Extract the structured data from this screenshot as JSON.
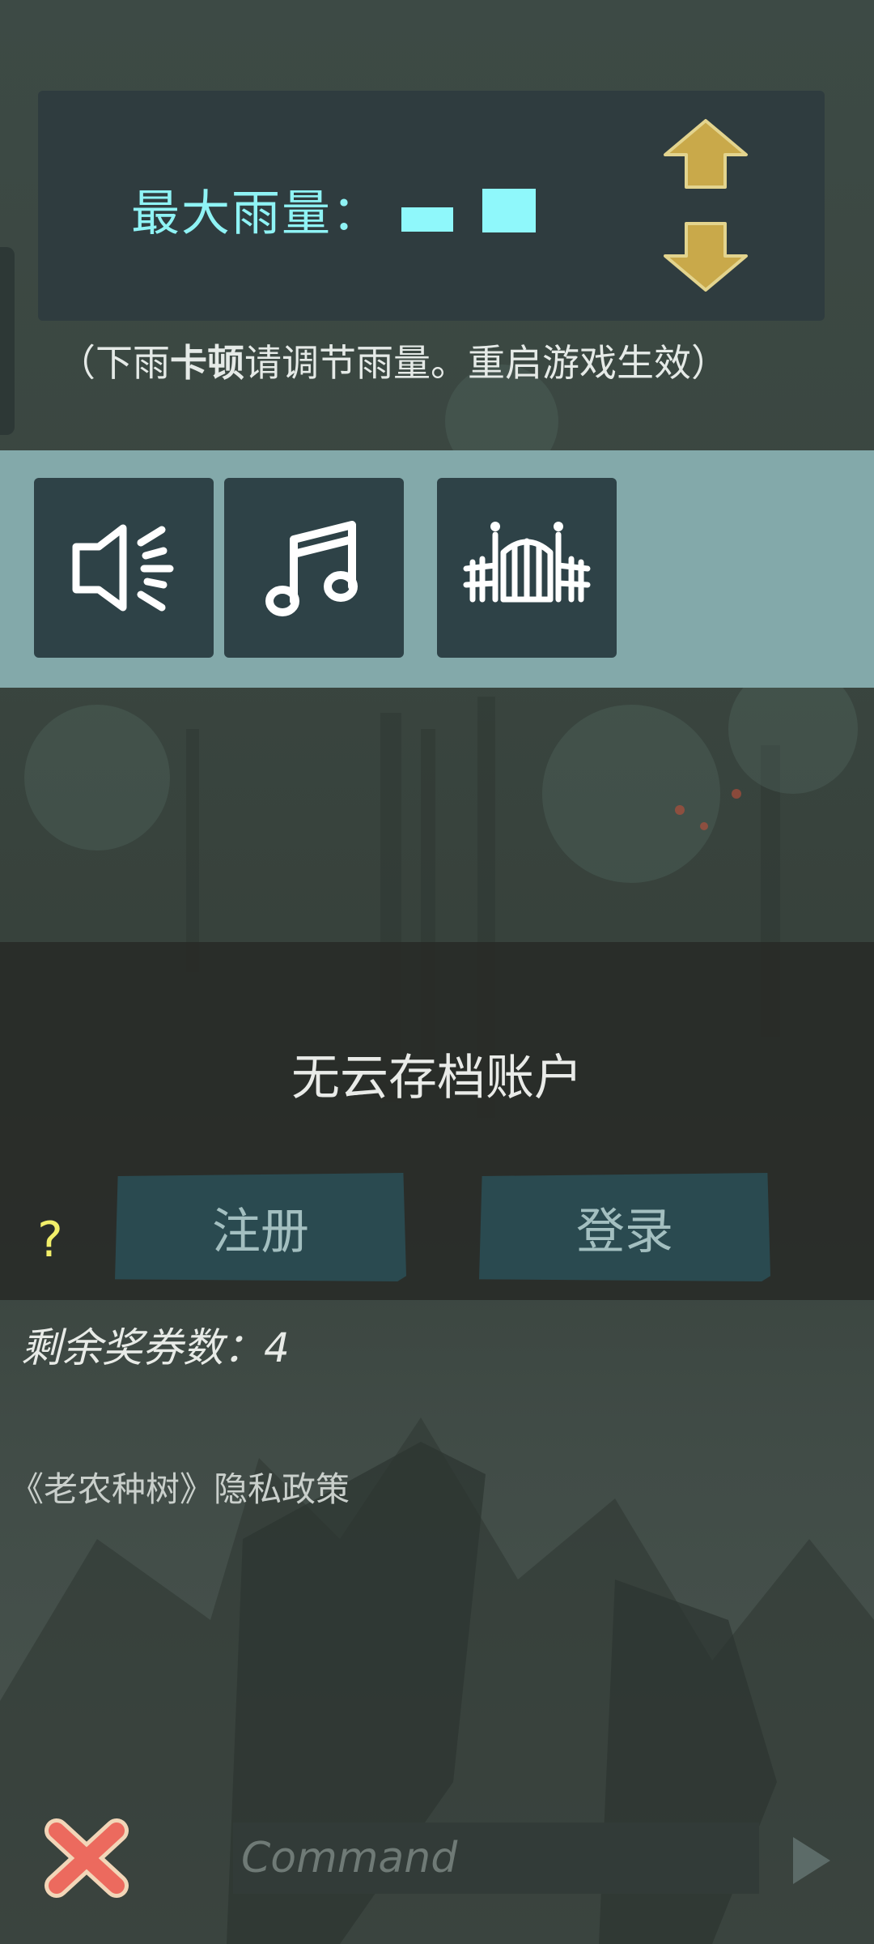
{
  "settings": {
    "rain_label": "最大雨量：",
    "rain_level": 2,
    "rain_hint": {
      "open": "（",
      "pre": "下雨",
      "bold": "卡顿",
      "post": "请调节雨量。重启游戏生效",
      "close": "）"
    }
  },
  "toolbar": {
    "items": [
      {
        "icon": "speaker-icon"
      },
      {
        "icon": "music-note-icon"
      },
      {
        "icon": "fence-gate-icon"
      }
    ]
  },
  "account": {
    "title": "无云存档账户",
    "register_label": "注册",
    "login_label": "登录",
    "help_label": "?"
  },
  "vouchers": {
    "text": "剩余奖券数：4"
  },
  "privacy": {
    "text": "《老农种树》隐私政策"
  },
  "command": {
    "placeholder": "Command"
  },
  "colors": {
    "accent_cyan": "#8ff3f5",
    "arrow_gold": "#c9a94a",
    "close_red": "#ec6a5e",
    "toolbar_bg": "#83a9aa",
    "button_dark": "#2e4247"
  }
}
